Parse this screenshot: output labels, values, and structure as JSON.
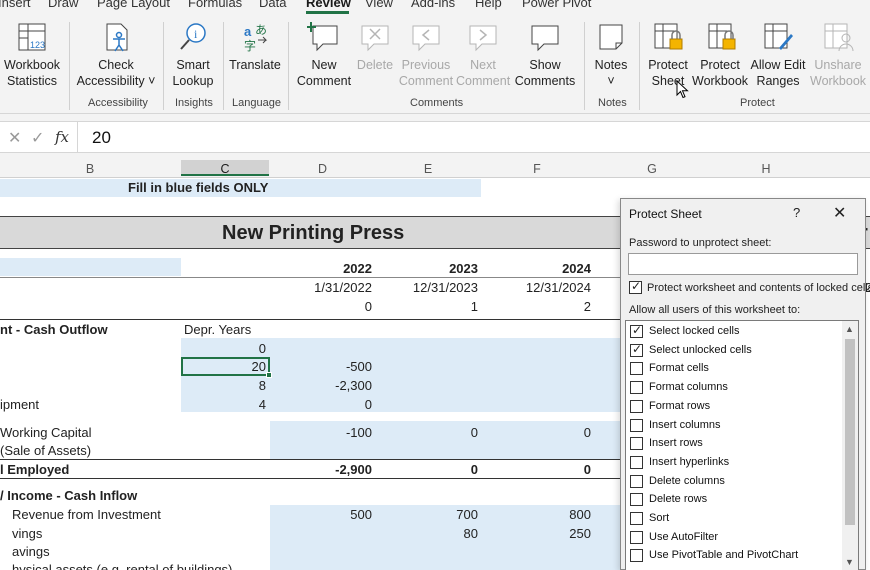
{
  "ribbon_tabs": [
    "Insert",
    "Draw",
    "Page Layout",
    "Formulas",
    "Data",
    "Review",
    "View",
    "Add-ins",
    "Help",
    "Power Pivot"
  ],
  "ribbon": {
    "proofing": {
      "workbook_statistics": "Workbook\nStatistics"
    },
    "accessibility": {
      "check_accessibility": "Check\nAccessibility ˅",
      "group": "Accessibility"
    },
    "insights": {
      "smart_lookup": "Smart\nLookup",
      "group": "Insights"
    },
    "language": {
      "translate": "Translate",
      "group": "Language"
    },
    "comments": {
      "new": "New\nComment",
      "delete": "Delete",
      "previous": "Previous\nComment",
      "next": "Next\nComment",
      "show": "Show\nComments",
      "group": "Comments"
    },
    "notes": {
      "notes": "Notes\n˅",
      "group": "Notes"
    },
    "protect": {
      "protect_sheet": "Protect\nSheet",
      "protect_workbook": "Protect\nWorkbook",
      "allow_edit_ranges": "Allow Edit\nRanges",
      "unshare_workbook": "Unshare\nWorkbook",
      "group": "Protect"
    }
  },
  "formula_bar": {
    "value": "20"
  },
  "columns": [
    "B",
    "C",
    "D",
    "E",
    "F",
    "G",
    "H"
  ],
  "sheet": {
    "banner": "Fill in blue fields ONLY",
    "title": "New Printing Press",
    "title_cut": "r",
    "years": [
      "2022",
      "2023",
      "2024"
    ],
    "dates": [
      "1/31/2022",
      "12/31/2023",
      "12/31/2024"
    ],
    "date_cut": "2",
    "periods": [
      "0",
      "1",
      "2"
    ],
    "section1": "nt - Cash Outflow",
    "depr_header": "Depr. Years",
    "rows": [
      {
        "label": "",
        "depr": "0",
        "d": "",
        "e": "",
        "f": ""
      },
      {
        "label": "",
        "depr": "20",
        "d": "-500",
        "e": "",
        "f": ""
      },
      {
        "label": "",
        "depr": "8",
        "d": "-2,300",
        "e": "",
        "f": ""
      },
      {
        "label": "ipment",
        "depr": "4",
        "d": "0",
        "e": "",
        "f": ""
      },
      {
        "label": "Working Capital",
        "depr": "",
        "d": "-100",
        "e": "0",
        "f": "0"
      },
      {
        "label": "(Sale of Assets)",
        "depr": "",
        "d": "",
        "e": "",
        "f": ""
      }
    ],
    "total_label": "l Employed",
    "totals": [
      "-2,900",
      "0",
      "0"
    ],
    "section2": "/ Income - Cash Inflow",
    "rows2": [
      {
        "label": "Revenue from Investment",
        "d": "500",
        "e": "700",
        "f": "800"
      },
      {
        "label": "vings",
        "d": "",
        "e": "80",
        "f": "250"
      },
      {
        "label": "avings",
        "d": "",
        "e": "",
        "f": ""
      },
      {
        "label": "hysical assets (e.g. rental of buildings)",
        "d": "",
        "e": "",
        "f": ""
      }
    ]
  },
  "dialog": {
    "title": "Protect Sheet",
    "help": "?",
    "close": "✕",
    "password_label": "Password to unprotect sheet:",
    "protect_contents": "Protect worksheet and contents of locked cells",
    "allow_label": "Allow all users of this worksheet to:",
    "options": [
      {
        "label": "Select locked cells",
        "checked": true
      },
      {
        "label": "Select unlocked cells",
        "checked": true
      },
      {
        "label": "Format cells",
        "checked": false
      },
      {
        "label": "Format columns",
        "checked": false
      },
      {
        "label": "Format rows",
        "checked": false
      },
      {
        "label": "Insert columns",
        "checked": false
      },
      {
        "label": "Insert rows",
        "checked": false
      },
      {
        "label": "Insert hyperlinks",
        "checked": false
      },
      {
        "label": "Delete columns",
        "checked": false
      },
      {
        "label": "Delete rows",
        "checked": false
      },
      {
        "label": "Sort",
        "checked": false
      },
      {
        "label": "Use AutoFilter",
        "checked": false
      },
      {
        "label": "Use PivotTable and PivotChart",
        "checked": false
      }
    ]
  },
  "colors": {
    "accent": "#217346",
    "input_fill": "#ddebf7",
    "ribbon_bg": "#f3f3f3"
  }
}
